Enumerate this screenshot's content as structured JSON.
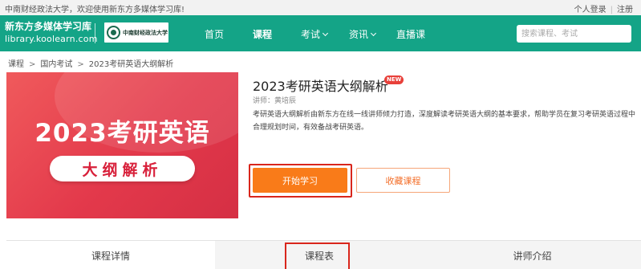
{
  "topbar": {
    "welcome": "中南财经政法大学，欢迎使用新东方多媒体学习库!",
    "login": "个人登录",
    "separator": "|",
    "register": "注册"
  },
  "header": {
    "brand_cn": "新东方多媒体学习库",
    "brand_en": "library.koolearn.com",
    "university_logo": "中南财经政法大学",
    "nav": [
      {
        "label": "首页",
        "active": false,
        "dropdown": false
      },
      {
        "label": "课程",
        "active": true,
        "dropdown": false
      },
      {
        "label": "考试",
        "active": false,
        "dropdown": true
      },
      {
        "label": "资讯",
        "active": false,
        "dropdown": true
      },
      {
        "label": "直播课",
        "active": false,
        "dropdown": false
      }
    ],
    "search_placeholder": "搜索课程、考试",
    "color": "#14a487"
  },
  "breadcrumb": {
    "items": [
      "课程",
      "国内考试",
      "2023考研英语大纲解析"
    ],
    "separator": ">"
  },
  "cover": {
    "main_text": "2023考研英语",
    "sub_text": "大纲解析"
  },
  "course": {
    "title": "2023考研英语大纲解析",
    "badge": "NEW",
    "lecturer": "讲师：黄培辰",
    "description": "考研英语大纲解析由新东方在线一线讲师倾力打造，深度解读考研英语大纲的基本要求，帮助学员在复习考研英语过程中合理规划时间，有效备战考研英语。",
    "start_button": "开始学习",
    "favorite_button": "收藏课程"
  },
  "tabs": [
    {
      "label": "课程详情",
      "active": true
    },
    {
      "label": "课程表",
      "active": false
    },
    {
      "label": "讲师介绍",
      "active": false
    }
  ]
}
